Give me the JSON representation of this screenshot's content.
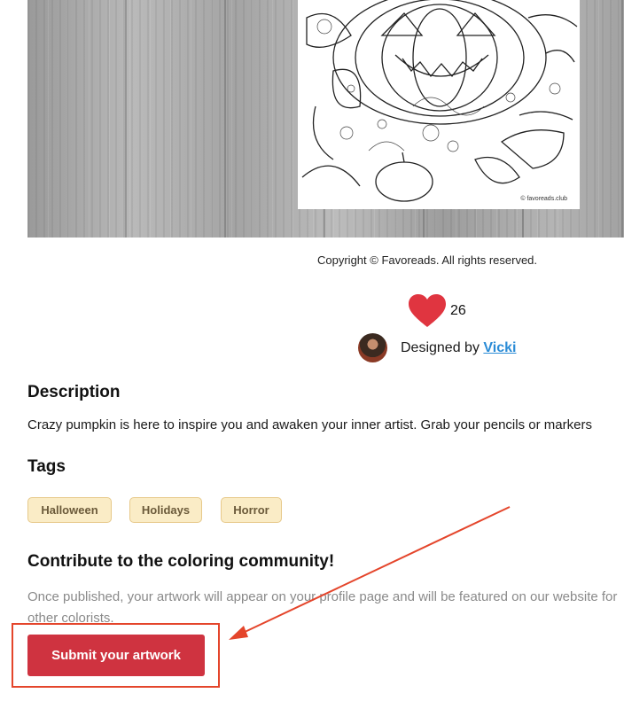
{
  "artwork": {
    "watermark": "© favoreads.club"
  },
  "copyright": "Copyright © Favoreads. All rights reserved.",
  "likes": {
    "icon": "heart-icon",
    "count": "26",
    "color": "#e03540"
  },
  "designer": {
    "prefix": "Designed by ",
    "name": "Vicki"
  },
  "description": {
    "heading": "Description",
    "text": "Crazy pumpkin is here to inspire you and awaken your inner artist. Grab your pencils or markers"
  },
  "tags": {
    "heading": "Tags",
    "items": [
      "Halloween",
      "Holidays",
      "Horror"
    ]
  },
  "contribute": {
    "heading": "Contribute to the coloring community!",
    "text": "Once published, your artwork will appear on your profile page and will be featured on our website for other colorists.",
    "button_label": "Submit your artwork",
    "accent": "#cf3340"
  },
  "annotation": {
    "color": "#e4452b"
  }
}
